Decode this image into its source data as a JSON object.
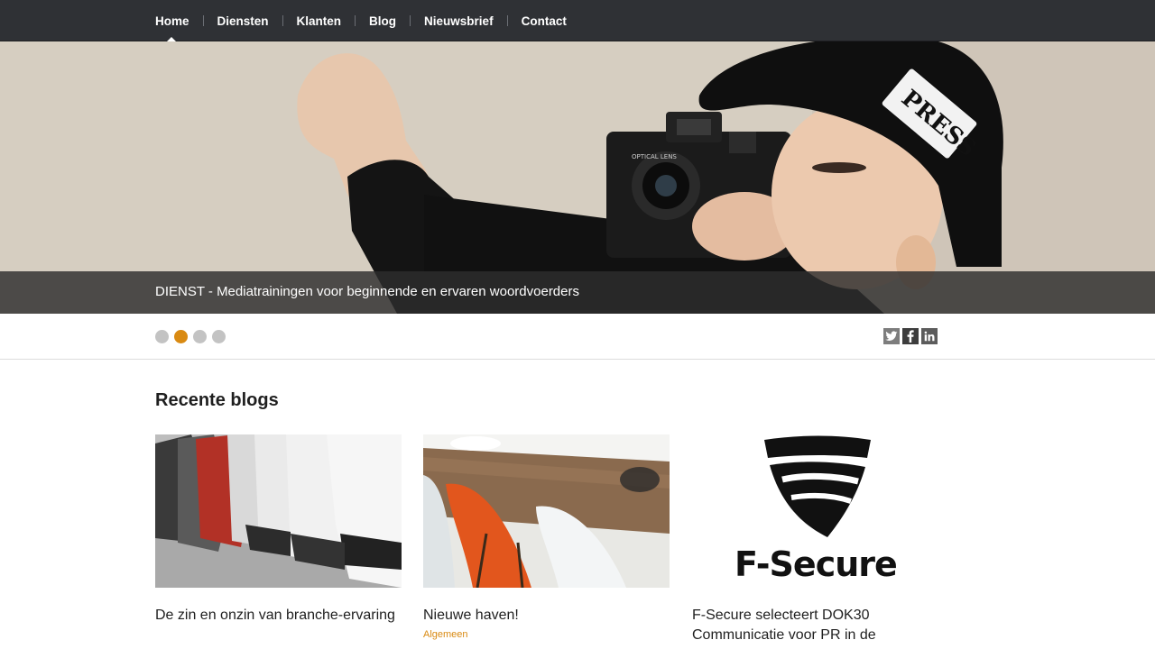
{
  "nav": {
    "items": [
      {
        "label": "Home"
      },
      {
        "label": "Diensten"
      },
      {
        "label": "Klanten"
      },
      {
        "label": "Blog"
      },
      {
        "label": "Nieuwsbrief"
      },
      {
        "label": "Contact"
      }
    ],
    "active": "Home"
  },
  "hero": {
    "caption": "DIENST - Mediatrainingen voor beginnende en ervaren woordvoerders",
    "hat_label": "PRESS",
    "lens_label": "OPTICAL LENS"
  },
  "slider": {
    "dot_count": 4,
    "active_index": 1
  },
  "social": {
    "icons": [
      "twitter-icon",
      "facebook-icon",
      "linkedin-icon"
    ]
  },
  "blogs": {
    "title": "Recente blogs",
    "items": [
      {
        "title": "De zin en onzin van branche-ervaring",
        "category": ""
      },
      {
        "title": "Nieuwe haven!",
        "category": "Algemeen"
      },
      {
        "title": "F-Secure selecteert DOK30 Communicatie voor PR in de",
        "category": "",
        "logo_text": "F-Secure"
      }
    ]
  },
  "colors": {
    "accent": "#d98a12",
    "nav_bg": "#2f3135"
  }
}
